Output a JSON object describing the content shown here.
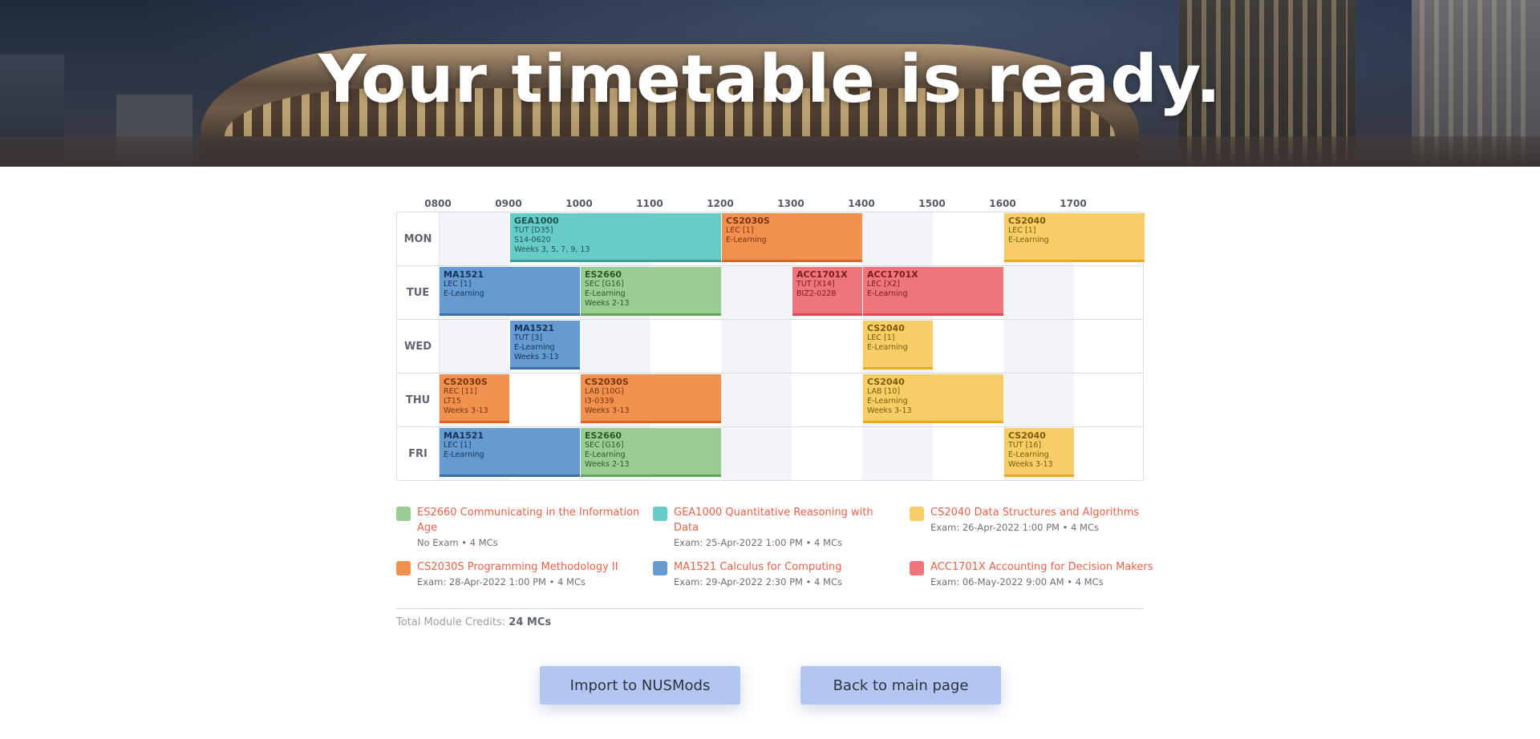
{
  "hero": {
    "title": "Your timetable is ready."
  },
  "timetable": {
    "hours": [
      "0800",
      "0900",
      "1000",
      "1100",
      "1200",
      "1300",
      "1400",
      "1500",
      "1600",
      "1700"
    ],
    "days": [
      "MON",
      "TUE",
      "WED",
      "THU",
      "FRI"
    ],
    "lessons": [
      {
        "day": 0,
        "start": 9,
        "end": 12,
        "color": "teal",
        "code": "GEA1000",
        "lines": [
          "TUT [D35]",
          "S14-0620",
          "Weeks 3, 5, 7, 9, 13"
        ]
      },
      {
        "day": 0,
        "start": 12,
        "end": 14,
        "color": "orange",
        "code": "CS2030S",
        "lines": [
          "LEC [1]",
          "E-Learning"
        ]
      },
      {
        "day": 0,
        "start": 16,
        "end": 18,
        "color": "yellow",
        "code": "CS2040",
        "lines": [
          "LEC [1]",
          "E-Learning"
        ]
      },
      {
        "day": 1,
        "start": 8,
        "end": 10,
        "color": "blue",
        "code": "MA1521",
        "lines": [
          "LEC [1]",
          "E-Learning"
        ]
      },
      {
        "day": 1,
        "start": 10,
        "end": 12,
        "color": "green",
        "code": "ES2660",
        "lines": [
          "SEC [G16]",
          "E-Learning",
          "Weeks 2-13"
        ]
      },
      {
        "day": 1,
        "start": 13,
        "end": 14,
        "color": "red",
        "code": "ACC1701X",
        "lines": [
          "TUT [X14]",
          "BIZ2-0228"
        ]
      },
      {
        "day": 1,
        "start": 14,
        "end": 16,
        "color": "red",
        "code": "ACC1701X",
        "lines": [
          "LEC [X2]",
          "E-Learning"
        ]
      },
      {
        "day": 2,
        "start": 9,
        "end": 10,
        "color": "blue",
        "code": "MA1521",
        "lines": [
          "TUT [3]",
          "E-Learning",
          "Weeks 3-13"
        ]
      },
      {
        "day": 2,
        "start": 14,
        "end": 15,
        "color": "yellow",
        "code": "CS2040",
        "lines": [
          "LEC [1]",
          "E-Learning"
        ]
      },
      {
        "day": 3,
        "start": 8,
        "end": 9,
        "color": "orange",
        "code": "CS2030S",
        "lines": [
          "REC [11]",
          "LT15",
          "Weeks 3-13"
        ]
      },
      {
        "day": 3,
        "start": 10,
        "end": 12,
        "color": "orange",
        "code": "CS2030S",
        "lines": [
          "LAB [10G]",
          "I3-0339",
          "Weeks 3-13"
        ]
      },
      {
        "day": 3,
        "start": 14,
        "end": 16,
        "color": "yellow",
        "code": "CS2040",
        "lines": [
          "LAB [10]",
          "E-Learning",
          "Weeks 3-13"
        ]
      },
      {
        "day": 4,
        "start": 8,
        "end": 10,
        "color": "blue",
        "code": "MA1521",
        "lines": [
          "LEC [1]",
          "E-Learning"
        ]
      },
      {
        "day": 4,
        "start": 10,
        "end": 12,
        "color": "green",
        "code": "ES2660",
        "lines": [
          "SEC [G16]",
          "E-Learning",
          "Weeks 2-13"
        ]
      },
      {
        "day": 4,
        "start": 16,
        "end": 17,
        "color": "yellow",
        "code": "CS2040",
        "lines": [
          "TUT [16]",
          "E-Learning",
          "Weeks 3-13"
        ]
      }
    ]
  },
  "modules": [
    {
      "color": "green",
      "title": "ES2660 Communicating in the Information Age",
      "meta": "No Exam • 4 MCs"
    },
    {
      "color": "teal",
      "title": "GEA1000 Quantitative Reasoning with Data",
      "meta": "Exam: 25-Apr-2022 1:00 PM • 4 MCs"
    },
    {
      "color": "yellow",
      "title": "CS2040 Data Structures and Algorithms",
      "meta": "Exam: 26-Apr-2022 1:00 PM • 4 MCs"
    },
    {
      "color": "orange",
      "title": "CS2030S Programming Methodology II",
      "meta": "Exam: 28-Apr-2022 1:00 PM • 4 MCs"
    },
    {
      "color": "blue",
      "title": "MA1521 Calculus for Computing",
      "meta": "Exam: 29-Apr-2022 2:30 PM • 4 MCs"
    },
    {
      "color": "red",
      "title": "ACC1701X Accounting for Decision Makers",
      "meta": "Exam: 06-May-2022 9:00 AM • 4 MCs"
    }
  ],
  "total": {
    "label": "Total Module Credits:",
    "value": "24 MCs"
  },
  "buttons": {
    "import": "Import to NUSMods",
    "back": "Back to main page"
  },
  "colors": {
    "teal": "#67ccc8",
    "orange": "#f0914f",
    "yellow": "#f7cd66",
    "blue": "#659bd0",
    "green": "#9acd94",
    "red": "#ee757a"
  }
}
